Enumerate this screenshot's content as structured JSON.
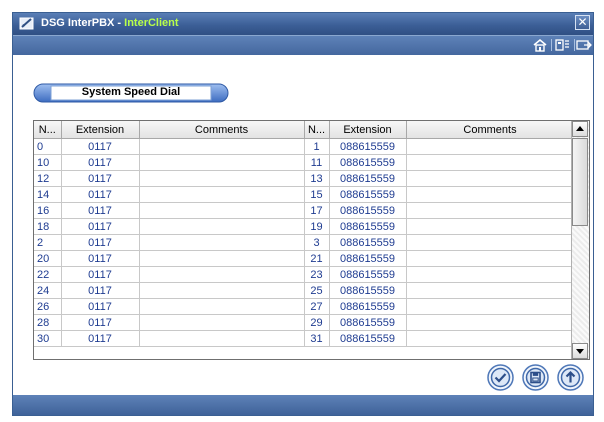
{
  "window": {
    "title": "DSG InterPBX",
    "title_separator": " - ",
    "subtitle": "InterClient",
    "close_glyph": "✕"
  },
  "toolbar": {
    "icons": [
      "home-icon",
      "phone-settings-icon",
      "exit-icon"
    ]
  },
  "section": {
    "label": "System Speed Dial"
  },
  "grid": {
    "headers": [
      "N...",
      "Extension",
      "Comments",
      "N...",
      "Extension",
      "Comments"
    ],
    "rows": [
      [
        "0",
        "0117",
        "",
        "1",
        "088615559",
        ""
      ],
      [
        "10",
        "0117",
        "",
        "11",
        "088615559",
        ""
      ],
      [
        "12",
        "0117",
        "",
        "13",
        "088615559",
        ""
      ],
      [
        "14",
        "0117",
        "",
        "15",
        "088615559",
        ""
      ],
      [
        "16",
        "0117",
        "",
        "17",
        "088615559",
        ""
      ],
      [
        "18",
        "0117",
        "",
        "19",
        "088615559",
        ""
      ],
      [
        "2",
        "0117",
        "",
        "3",
        "088615559",
        ""
      ],
      [
        "20",
        "0117",
        "",
        "21",
        "088615559",
        ""
      ],
      [
        "22",
        "0117",
        "",
        "23",
        "088615559",
        ""
      ],
      [
        "24",
        "0117",
        "",
        "25",
        "088615559",
        ""
      ],
      [
        "26",
        "0117",
        "",
        "27",
        "088615559",
        ""
      ],
      [
        "28",
        "0117",
        "",
        "29",
        "088615559",
        ""
      ],
      [
        "30",
        "0117",
        "",
        "31",
        "088615559",
        ""
      ]
    ]
  },
  "actions": {
    "icons": [
      "confirm-check-icon",
      "save-disk-icon",
      "upload-arrow-icon"
    ]
  },
  "colors": {
    "titlebar": "#3c5f97",
    "subtitle": "#b8ff4a",
    "cell_text": "#1f3c91",
    "button_ring": "#4f78b8"
  }
}
